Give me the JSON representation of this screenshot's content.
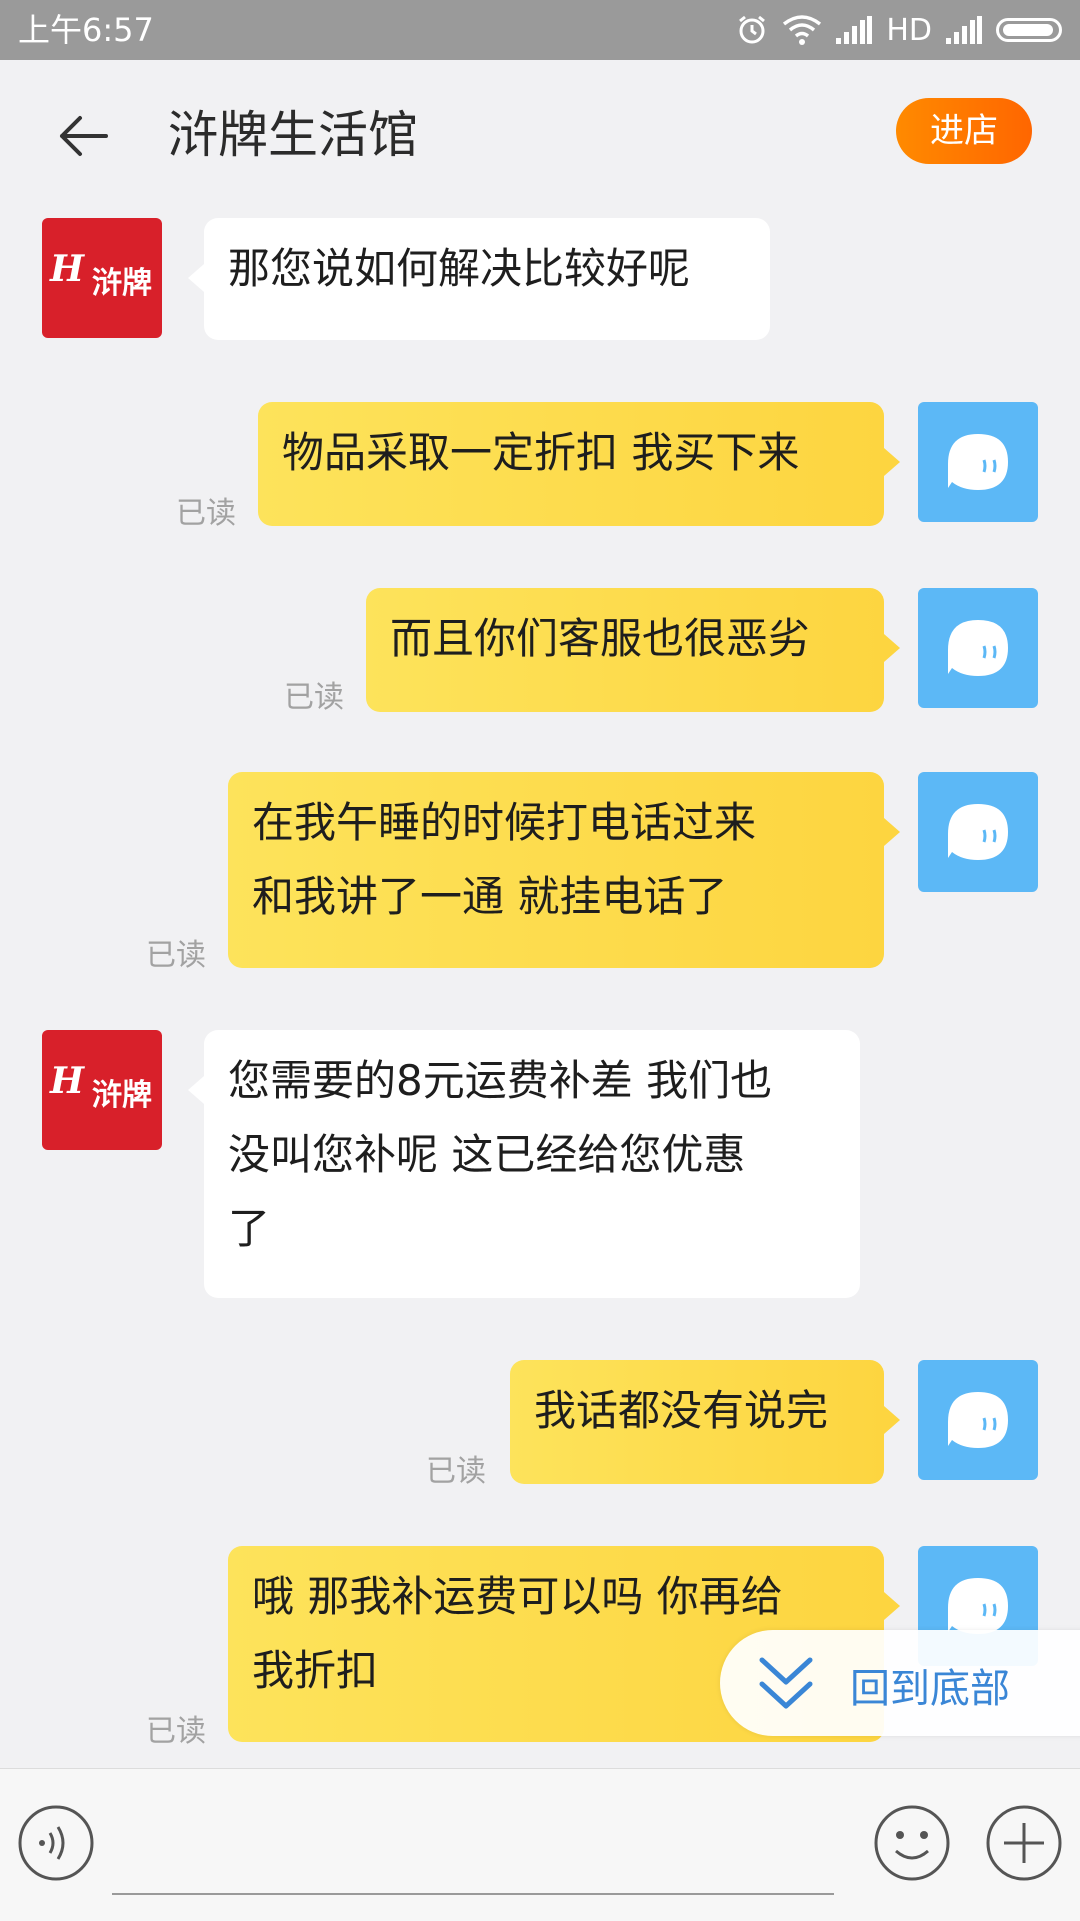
{
  "status": {
    "time": "上午6:57",
    "network": "HD"
  },
  "header": {
    "title": "浒牌生活馆",
    "enter_shop": "进店"
  },
  "shop_logo": {
    "latin": "H",
    "chinese": "浒牌"
  },
  "messages": [
    {
      "side": "in",
      "text": "那您说如何解决比较好呢"
    },
    {
      "side": "out",
      "text": "物品采取一定折扣 我买下来",
      "read": "已读"
    },
    {
      "side": "out",
      "text": "而且你们客服也很恶劣",
      "read": "已读"
    },
    {
      "side": "out",
      "text": "在我午睡的时候打电话过来\n和我讲了一通 就挂电话了",
      "read": "已读"
    },
    {
      "side": "in",
      "text": "您需要的8元运费补差 我们也\n没叫您补呢 这已经给您优惠\n了"
    },
    {
      "side": "out",
      "text": "我话都没有说完",
      "read": "已读"
    },
    {
      "side": "out",
      "text": "哦 那我补运费可以吗 你再给\n我折扣",
      "read": "已读"
    }
  ],
  "back_to_bottom": "回到底部",
  "icons": {
    "back": "arrow-left-icon",
    "voice": "voice-icon",
    "emoji": "emoji-icon",
    "plus": "plus-icon"
  }
}
